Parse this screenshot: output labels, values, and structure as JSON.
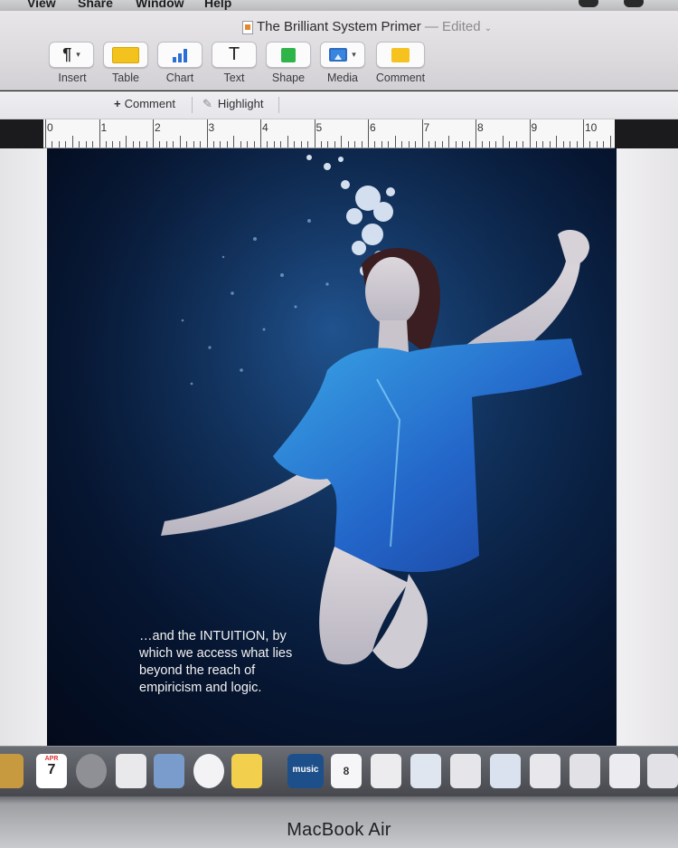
{
  "menubar": {
    "items": [
      "View",
      "Share",
      "Window",
      "Help"
    ]
  },
  "window": {
    "title": "The Brilliant System Primer",
    "status": "— Edited"
  },
  "toolbar": {
    "insert": "Insert",
    "table": "Table",
    "chart": "Chart",
    "text": "Text",
    "shape": "Shape",
    "media": "Media",
    "comment": "Comment",
    "cut_label": "Co",
    "text_glyph": "T",
    "insert_glyph": "¶"
  },
  "strip": {
    "comment": "Comment",
    "highlight": "Highlight"
  },
  "ruler": {
    "numbers": [
      "0",
      "1",
      "2",
      "3",
      "4",
      "5",
      "6",
      "7",
      "8",
      "9",
      "10"
    ]
  },
  "page": {
    "caption": [
      "…and the INTUITION, by",
      "which we access what lies",
      "beyond the reach of",
      "empiricism and logic."
    ]
  },
  "dock": {
    "calendar_month": "APR",
    "calendar_day": "7",
    "music_label": "music",
    "contacts_day": "8"
  },
  "device": {
    "brand": "MacBook Air"
  },
  "colors": {
    "accent_table": "#f4c21c",
    "accent_chart": "#2b6fd6",
    "accent_shape": "#2fb44a",
    "accent_media": "#3a85e0",
    "page_bg": "#061530",
    "shirt": "#2a7ad6"
  }
}
